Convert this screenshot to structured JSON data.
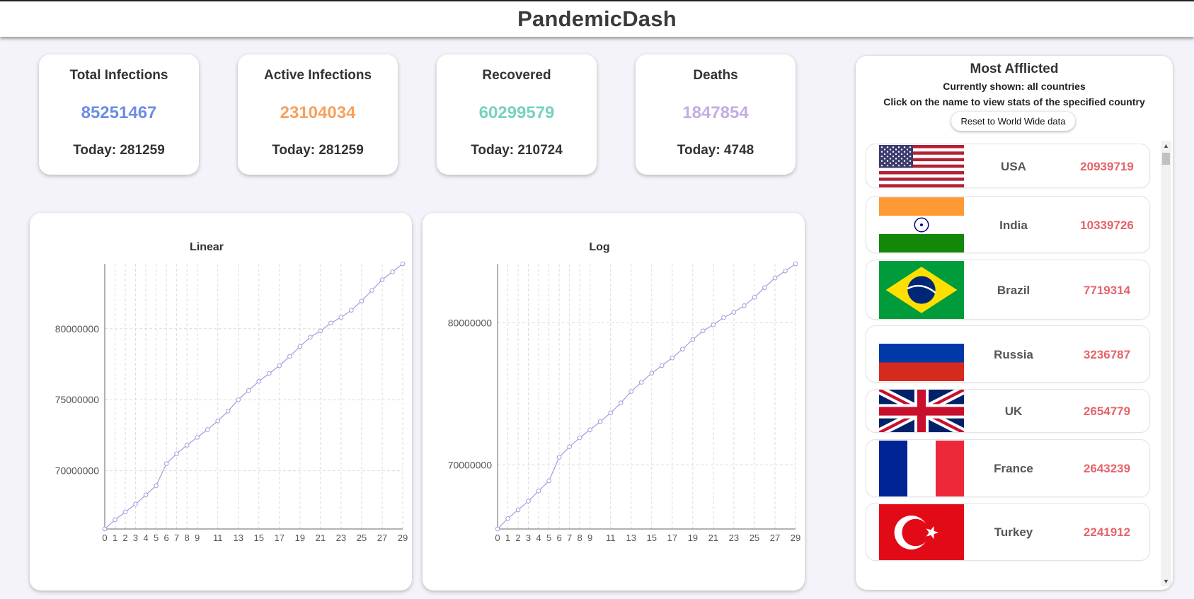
{
  "app": {
    "title": "PandemicDash"
  },
  "stats": [
    {
      "title": "Total Infections",
      "value": "85251467",
      "today": "Today: 281259",
      "color": "#6b8ee3"
    },
    {
      "title": "Active Infections",
      "value": "23104034",
      "today": "Today: 281259",
      "color": "#f7a15e"
    },
    {
      "title": "Recovered",
      "value": "60299579",
      "today": "Today: 210724",
      "color": "#76d3bf"
    },
    {
      "title": "Deaths",
      "value": "1847854",
      "today": "Today: 4748",
      "color": "#c4ade2"
    }
  ],
  "panel": {
    "title": "Most Afflicted",
    "shown": "Currently shown: all countries",
    "hint": "Click on the name to view stats of the specified country",
    "reset_label": "Reset to World Wide data",
    "scroll_up": "▲",
    "scroll_down": "▼",
    "countries": [
      {
        "name": "USA",
        "count": "20939719",
        "flag": "usa-flag-icon"
      },
      {
        "name": "India",
        "count": "10339726",
        "flag": "india-flag-icon"
      },
      {
        "name": "Brazil",
        "count": "7719314",
        "flag": "brazil-flag-icon"
      },
      {
        "name": "Russia",
        "count": "3236787",
        "flag": "russia-flag-icon"
      },
      {
        "name": "UK",
        "count": "2654779",
        "flag": "uk-flag-icon"
      },
      {
        "name": "France",
        "count": "2643239",
        "flag": "france-flag-icon"
      },
      {
        "name": "Turkey",
        "count": "2241912",
        "flag": "turkey-flag-icon"
      }
    ]
  },
  "chart_data": [
    {
      "type": "line",
      "title": "Linear",
      "xlabel": "",
      "ylabel": "",
      "line_color": "#a59be0",
      "grid": true,
      "x": [
        0,
        1,
        2,
        3,
        4,
        5,
        6,
        7,
        8,
        9,
        10,
        11,
        12,
        13,
        14,
        15,
        16,
        17,
        18,
        19,
        20,
        21,
        22,
        23,
        24,
        25,
        26,
        27,
        28,
        29
      ],
      "x_tick_labels": [
        "0",
        "1",
        "2",
        "3",
        "4",
        "5",
        "6",
        "7",
        "8",
        "9",
        "11",
        "13",
        "15",
        "17",
        "19",
        "21",
        "23",
        "25",
        "27",
        "29"
      ],
      "y_ticks": [
        70000000,
        75000000,
        80000000
      ],
      "y_tick_labels": [
        "70000000",
        "75000000",
        "80000000"
      ],
      "ylim": [
        65900000,
        84570000
      ],
      "values": [
        65900000,
        66550000,
        67100000,
        67650000,
        68300000,
        68950000,
        70500000,
        71200000,
        71800000,
        72350000,
        72900000,
        73500000,
        74200000,
        75000000,
        75650000,
        76300000,
        76850000,
        77400000,
        78050000,
        78750000,
        79400000,
        79850000,
        80400000,
        80800000,
        81300000,
        81950000,
        82700000,
        83450000,
        84000000,
        84570000
      ]
    },
    {
      "type": "line",
      "title": "Log",
      "xlabel": "",
      "ylabel": "",
      "line_color": "#a59be0",
      "grid": true,
      "scale": "log",
      "x": [
        0,
        1,
        2,
        3,
        4,
        5,
        6,
        7,
        8,
        9,
        10,
        11,
        12,
        13,
        14,
        15,
        16,
        17,
        18,
        19,
        20,
        21,
        22,
        23,
        24,
        25,
        26,
        27,
        28,
        29
      ],
      "x_tick_labels": [
        "0",
        "1",
        "2",
        "3",
        "4",
        "5",
        "6",
        "7",
        "8",
        "9",
        "11",
        "13",
        "15",
        "17",
        "19",
        "21",
        "23",
        "25",
        "27",
        "29"
      ],
      "y_ticks": [
        70000000,
        80000000
      ],
      "y_tick_labels": [
        "70000000",
        "80000000"
      ],
      "ylim": [
        65900000,
        84570000
      ],
      "values": [
        65900000,
        66550000,
        67100000,
        67650000,
        68300000,
        68950000,
        70500000,
        71200000,
        71800000,
        72350000,
        72900000,
        73500000,
        74200000,
        75000000,
        75650000,
        76300000,
        76850000,
        77400000,
        78050000,
        78750000,
        79400000,
        79850000,
        80400000,
        80800000,
        81300000,
        81950000,
        82700000,
        83450000,
        84000000,
        84570000
      ]
    }
  ]
}
